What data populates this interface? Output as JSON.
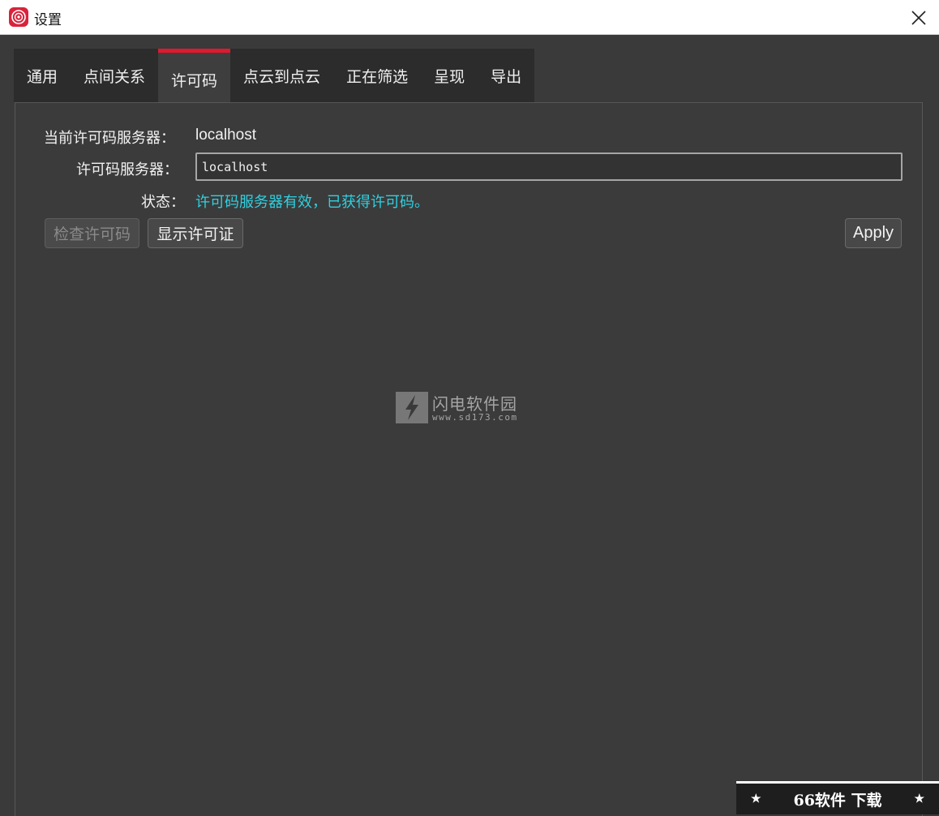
{
  "window": {
    "title": "设置",
    "close_icon": "close-icon",
    "app_icon": "app-logo-icon"
  },
  "tabs": [
    {
      "label": "通用",
      "active": false
    },
    {
      "label": "点间关系",
      "active": false
    },
    {
      "label": "许可码",
      "active": true
    },
    {
      "label": "点云到点云",
      "active": false
    },
    {
      "label": "正在筛选",
      "active": false
    },
    {
      "label": "呈现",
      "active": false
    },
    {
      "label": "导出",
      "active": false
    }
  ],
  "license": {
    "current_server_label": "当前许可码服务器：",
    "current_server_value": "localhost",
    "server_label": "许可码服务器：",
    "server_input_value": "localhost",
    "status_label": "状态：",
    "status_text": "许可码服务器有效，已获得许可码。"
  },
  "buttons": {
    "check_license": "检查许可码",
    "show_license": "显示许可证",
    "apply": "Apply"
  },
  "colors": {
    "accent": "#e0192f",
    "status": "#2fd0e0",
    "background": "#3a3a3a"
  },
  "watermark": {
    "title": "闪电软件园",
    "url": "www.sd173.com"
  },
  "corner_badge": {
    "text": "66软件 下载",
    "star": "★"
  }
}
